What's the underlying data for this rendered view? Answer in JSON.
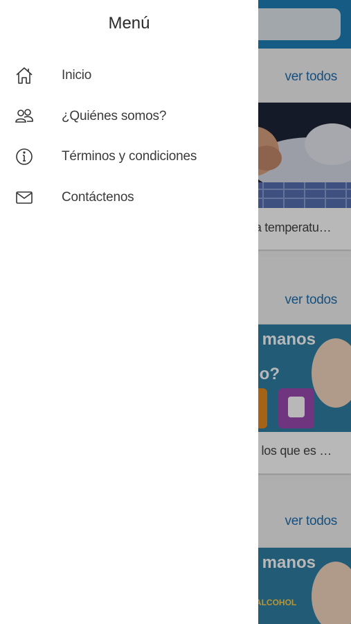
{
  "drawer": {
    "title": "Menú",
    "items": [
      {
        "label": "Inicio",
        "icon": "home-icon"
      },
      {
        "label": "¿Quiénes somos?",
        "icon": "users-icon"
      },
      {
        "label": "Términos y condiciones",
        "icon": "info-icon"
      },
      {
        "label": "Contáctenos",
        "icon": "mail-icon"
      }
    ]
  },
  "background": {
    "accent_color": "#1f7fb8",
    "sections": [
      {
        "see_all": "ver todos",
        "caption": "de la temperatu…"
      },
      {
        "see_all": "ver todos",
        "caption": "s en los que es …",
        "banner_line1": "tus manos",
        "banner_line2": "ándo?"
      },
      {
        "see_all": "ver todos",
        "banner_line1": "tus manos",
        "banner_line3": "SE DE ALCOHOL"
      }
    ]
  }
}
